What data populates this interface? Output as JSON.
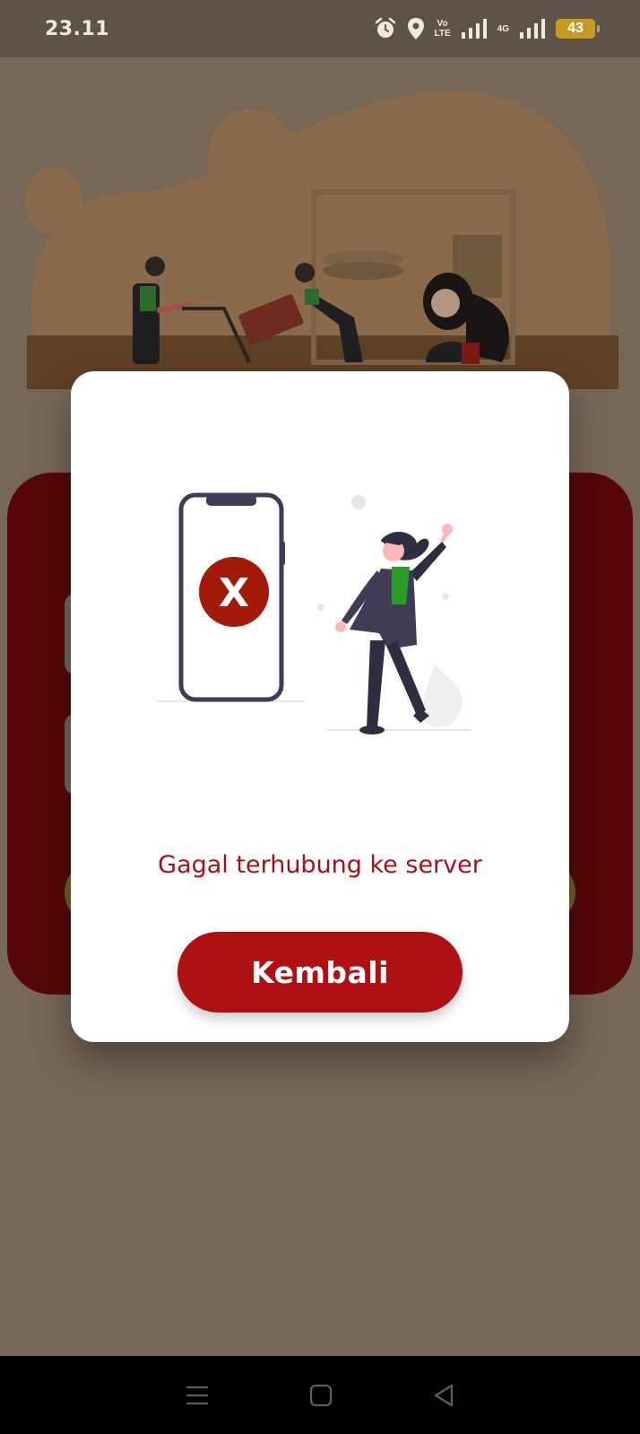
{
  "status_bar": {
    "time": "23.11",
    "network_label": "Vo LTE",
    "network_label_top": "Vo",
    "network_label_bottom": "LTE",
    "data_label": "4G",
    "battery_level": "43",
    "battery_color": "#c59a24"
  },
  "dialog": {
    "message": "Gagal terhubung ke server",
    "button_label": "Kembali",
    "error_mark": "X",
    "icons": [
      "phone-error-icon",
      "person-waving-illustration"
    ],
    "accent_color": "#ae1013"
  },
  "navigation_bar": {
    "icons": [
      "menu-icon",
      "home-icon",
      "back-icon"
    ]
  },
  "colors": {
    "overlay": "#776757",
    "background_card": "#570708",
    "dialog_background": "#ffffff",
    "message_text": "#a3121a"
  }
}
